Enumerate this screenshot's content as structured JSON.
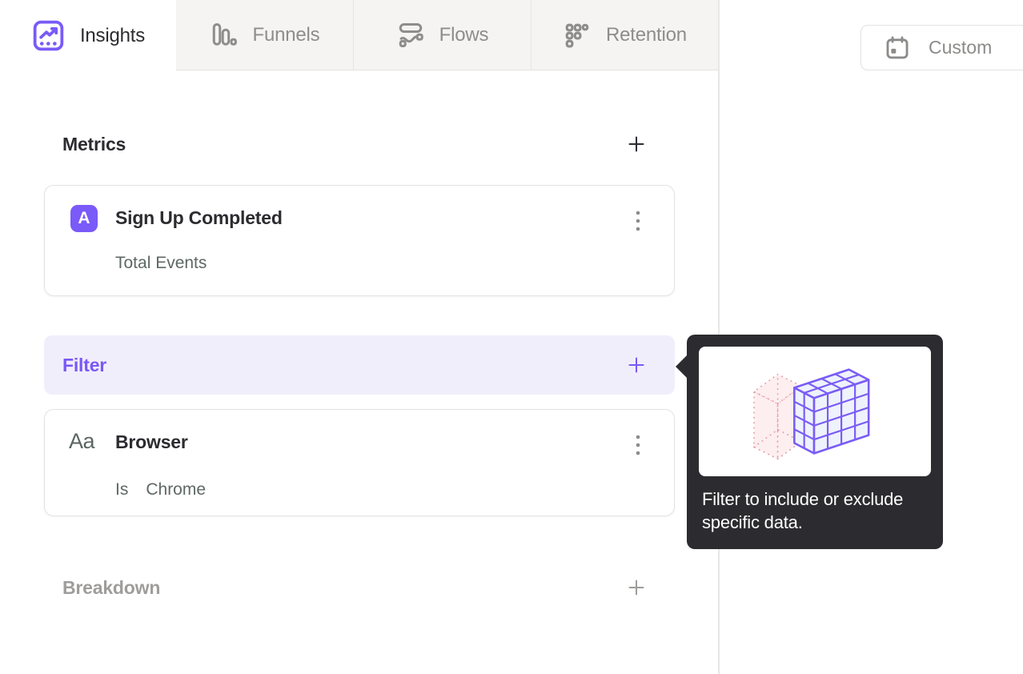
{
  "tabs": [
    {
      "label": "Insights",
      "icon": "insights-chart-icon",
      "active": true
    },
    {
      "label": "Funnels",
      "icon": "funnel-bars-icon",
      "active": false
    },
    {
      "label": "Flows",
      "icon": "flows-wave-icon",
      "active": false
    },
    {
      "label": "Retention",
      "icon": "retention-dots-icon",
      "active": false
    }
  ],
  "date_range_button": {
    "label": "Custom",
    "icon": "calendar-icon"
  },
  "sections": {
    "metrics": {
      "title": "Metrics"
    },
    "filter": {
      "title": "Filter"
    },
    "breakdown": {
      "title": "Breakdown"
    }
  },
  "metric_card": {
    "badge": "A",
    "title": "Sign Up Completed",
    "subtitle": "Total Events"
  },
  "filter_card": {
    "type_glyph": "Aa",
    "title": "Browser",
    "operator": "Is",
    "value": "Chrome"
  },
  "tooltip": {
    "text": "Filter to include or exclude specific data."
  },
  "colors": {
    "accent_purple": "#7a5af8",
    "filter_row_bg": "#f1eefc",
    "tooltip_bg": "#2c2c30",
    "tab_bg": "#f5f4f2",
    "dark_text": "#2c2b30",
    "muted_text": "#8e8d8b",
    "subtle_text": "#5d6864",
    "cube_purple": "#7a5cf5",
    "cube_pink": "#e39ba4"
  }
}
